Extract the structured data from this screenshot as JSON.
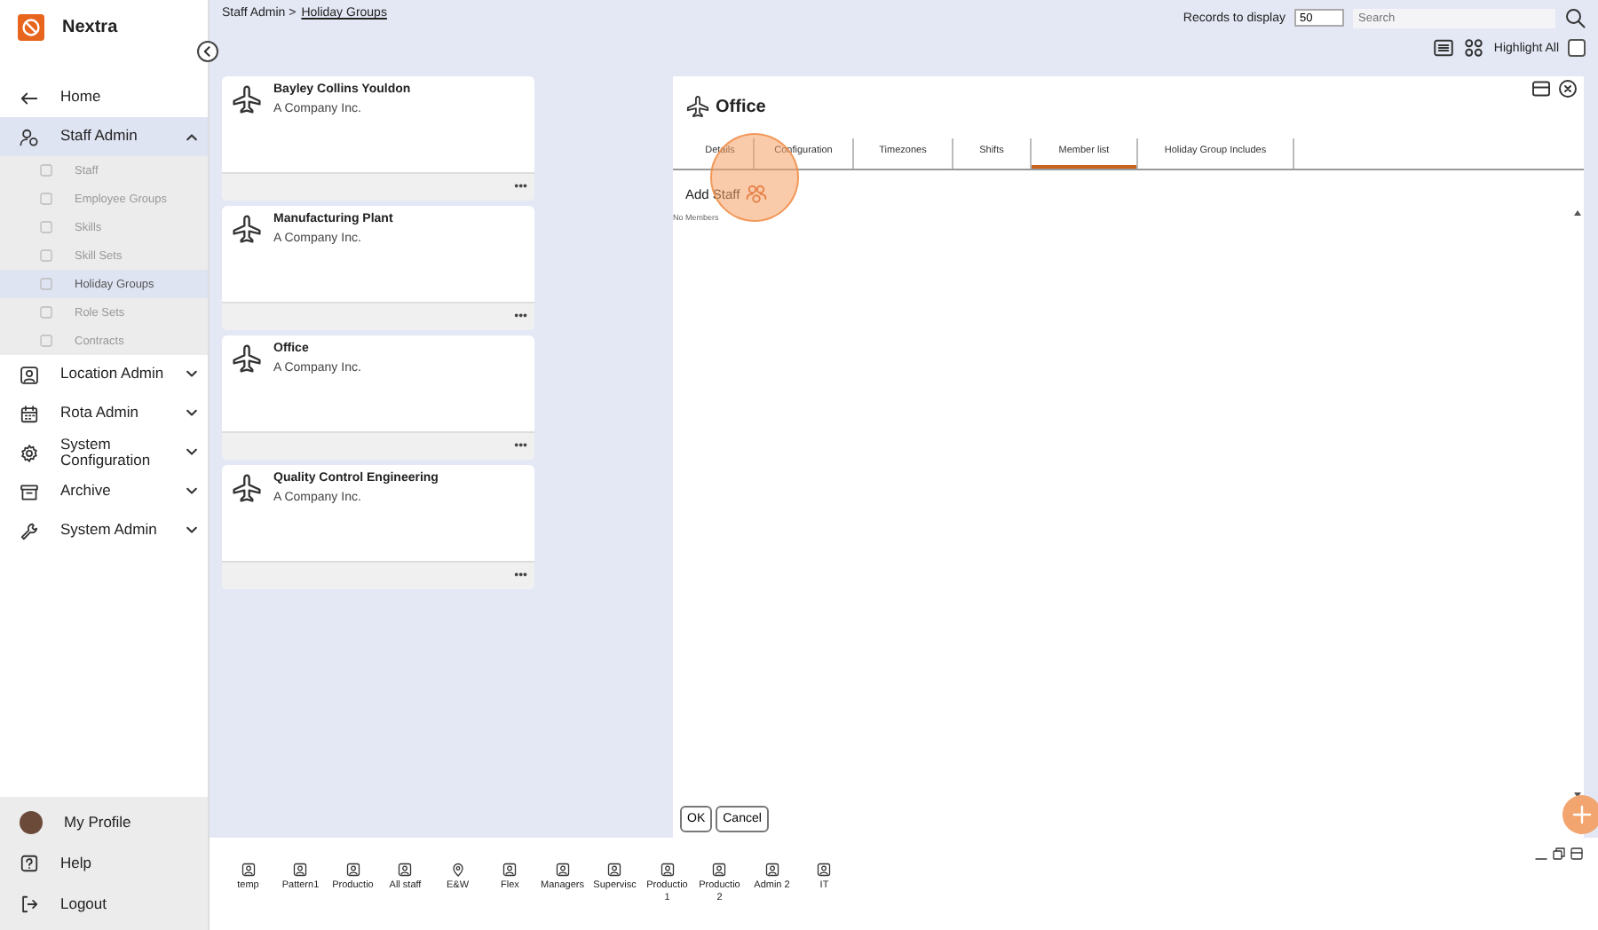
{
  "app": {
    "name": "Nextra"
  },
  "sidebar": {
    "items": [
      {
        "label": "Home",
        "kind": "back",
        "selected": false
      },
      {
        "label": "Staff Admin",
        "kind": "people",
        "expanded": true,
        "selected": true,
        "children": [
          {
            "label": "Staff",
            "selected": false
          },
          {
            "label": "Employee Groups",
            "selected": false
          },
          {
            "label": "Skills",
            "selected": false
          },
          {
            "label": "Skill Sets",
            "selected": false
          },
          {
            "label": "Holiday Groups",
            "selected": true
          },
          {
            "label": "Role Sets",
            "selected": false
          },
          {
            "label": "Contracts",
            "selected": false
          }
        ]
      },
      {
        "label": "Location Admin",
        "kind": "location",
        "expanded": false,
        "selected": false
      },
      {
        "label": "Rota Admin",
        "kind": "calendar",
        "expanded": false,
        "selected": false
      },
      {
        "label": "System Configuration",
        "kind": "gear",
        "expanded": false,
        "selected": false
      },
      {
        "label": "Archive",
        "kind": "archive",
        "expanded": false,
        "selected": false
      },
      {
        "label": "System Admin",
        "kind": "wrench",
        "expanded": false,
        "selected": false
      }
    ],
    "footer": [
      {
        "label": "My Profile",
        "kind": "avatar"
      },
      {
        "label": "Help",
        "kind": "help"
      },
      {
        "label": "Logout",
        "kind": "logout"
      }
    ]
  },
  "breadcrumb": {
    "parent": "Staff Admin >",
    "current": "Holiday Groups"
  },
  "toolbar": {
    "records_label": "Records to display",
    "records_value": "50",
    "search_placeholder": "Search",
    "highlight_label": "Highlight All",
    "highlight_checked": false
  },
  "cards": [
    {
      "title": "Bayley Collins Youldon",
      "subtitle": "A Company Inc.",
      "more": "•••"
    },
    {
      "title": "Manufacturing Plant",
      "subtitle": "A Company Inc.",
      "more": "•••"
    },
    {
      "title": "Office",
      "subtitle": "A Company Inc.",
      "more": "•••"
    },
    {
      "title": "Quality Control Engineering",
      "subtitle": "A Company Inc.",
      "more": "•••"
    }
  ],
  "detail": {
    "title": "Office",
    "tabs": [
      {
        "label": "Details",
        "selected": false
      },
      {
        "label": "Configuration",
        "selected": false
      },
      {
        "label": "Timezones",
        "selected": false
      },
      {
        "label": "Shifts",
        "selected": false
      },
      {
        "label": "Member list",
        "selected": true
      },
      {
        "label": "Holiday Group Includes",
        "selected": false
      }
    ],
    "add_label": "Add Staff",
    "empty_text": "No Members",
    "buttons": [
      "OK",
      "Cancel"
    ]
  },
  "click_marker": true,
  "taskbar": [
    {
      "label": "temp",
      "kind": "person"
    },
    {
      "label": "Pattern1",
      "kind": "person"
    },
    {
      "label": "Productio",
      "kind": "person"
    },
    {
      "label": "All staff",
      "kind": "person"
    },
    {
      "label": "E&W",
      "kind": "pin"
    },
    {
      "label": "Flex",
      "kind": "person"
    },
    {
      "label": "Managers",
      "kind": "person"
    },
    {
      "label": "Supervisc",
      "kind": "person"
    },
    {
      "label": "Productio 1",
      "kind": "person"
    },
    {
      "label": "Productio 2",
      "kind": "person"
    },
    {
      "label": "Admin 2",
      "kind": "person"
    },
    {
      "label": "IT",
      "kind": "person"
    }
  ]
}
